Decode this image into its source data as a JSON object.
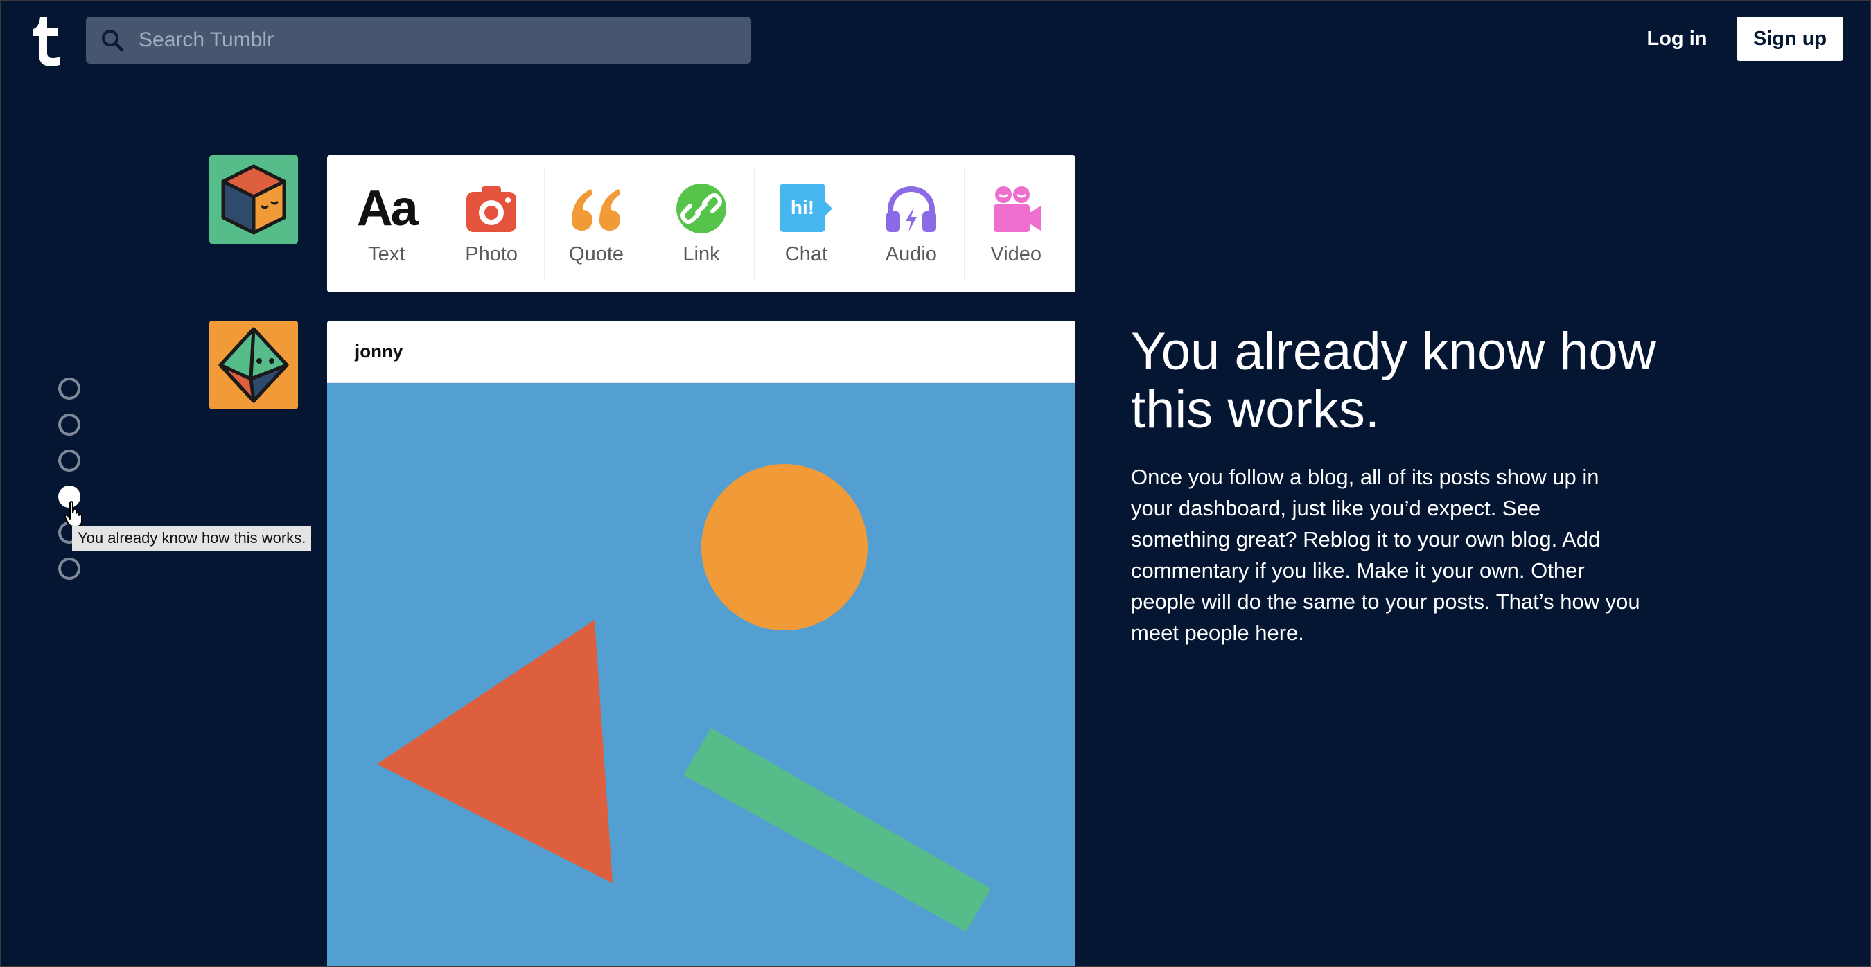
{
  "header": {
    "logo_icon": "tumblr-logo-icon",
    "search": {
      "placeholder": "Search Tumblr",
      "value": "",
      "icon": "search-icon"
    },
    "login_label": "Log in",
    "signup_label": "Sign up"
  },
  "side_nav": {
    "dot_count": 6,
    "active_index": 3,
    "tooltip": "You already know how this works."
  },
  "post_types": [
    {
      "label": "Text",
      "icon": "text-aa-icon",
      "glyph": "Aa",
      "color": "#111111"
    },
    {
      "label": "Photo",
      "icon": "camera-icon",
      "color": "#e5533d"
    },
    {
      "label": "Quote",
      "icon": "quote-icon",
      "color": "#f19a38"
    },
    {
      "label": "Link",
      "icon": "link-icon",
      "color": "#56c34a"
    },
    {
      "label": "Chat",
      "icon": "chat-bubble-icon",
      "glyph": "hi!",
      "color": "#45b6ee"
    },
    {
      "label": "Audio",
      "icon": "headphones-icon",
      "color": "#8b6ae6"
    },
    {
      "label": "Video",
      "icon": "video-camera-icon",
      "color": "#ee6fce"
    }
  ],
  "post": {
    "author": "jonny",
    "image_colors": {
      "background": "#539fd1",
      "circle": "#f19a38",
      "triangle": "#dd5f3e",
      "bar": "#56bc8a"
    }
  },
  "hero": {
    "headline": "You already know how this works.",
    "description": "Once you follow a blog, all of its posts show up in your dashboard, just like you’d expect. See something great? Reblog it to your own blog. Add commentary if you like. Make it your own. Other people will do the same to your posts. That’s how you meet people here."
  },
  "colors": {
    "background": "#051633",
    "search_bg": "#46566e",
    "avatar_cube_bg": "#56bc8a",
    "avatar_gem_bg": "#f19a38"
  }
}
